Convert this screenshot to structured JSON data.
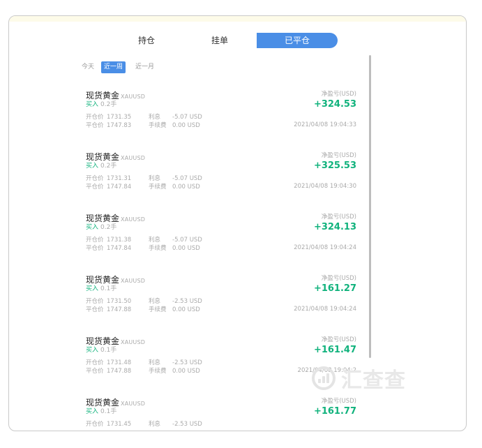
{
  "tabs": [
    {
      "label": "持仓",
      "active": false
    },
    {
      "label": "挂单",
      "active": false
    },
    {
      "label": "已平仓",
      "active": true
    }
  ],
  "filters": [
    {
      "label": "今天",
      "active": false
    },
    {
      "label": "近一周",
      "active": true
    },
    {
      "label": "近一月",
      "active": false
    }
  ],
  "trades": [
    {
      "name": "现货黄金",
      "symbol": "XAUUSD",
      "side": "买入",
      "qty": "0.2手",
      "open_label": "开仓价",
      "open_price": "1731.35",
      "close_label": "平仓价",
      "close_price": "1747.83",
      "interest_label": "利息",
      "interest": "-5.07 USD",
      "fee_label": "手续费",
      "fee": "0.00 USD",
      "pnl_label": "净盈亏(USD)",
      "pnl": "+324.53",
      "time": "2021/04/08 19:04:33"
    },
    {
      "name": "现货黄金",
      "symbol": "XAUUSD",
      "side": "买入",
      "qty": "0.2手",
      "open_label": "开仓价",
      "open_price": "1731.31",
      "close_label": "平仓价",
      "close_price": "1747.84",
      "interest_label": "利息",
      "interest": "-5.07 USD",
      "fee_label": "手续费",
      "fee": "0.00 USD",
      "pnl_label": "净盈亏(USD)",
      "pnl": "+325.53",
      "time": "2021/04/08 19:04:30"
    },
    {
      "name": "现货黄金",
      "symbol": "XAUUSD",
      "side": "买入",
      "qty": "0.2手",
      "open_label": "开仓价",
      "open_price": "1731.38",
      "close_label": "平仓价",
      "close_price": "1747.84",
      "interest_label": "利息",
      "interest": "-5.07 USD",
      "fee_label": "手续费",
      "fee": "0.00 USD",
      "pnl_label": "净盈亏(USD)",
      "pnl": "+324.13",
      "time": "2021/04/08 19:04:24"
    },
    {
      "name": "现货黄金",
      "symbol": "XAUUSD",
      "side": "买入",
      "qty": "0.1手",
      "open_label": "开仓价",
      "open_price": "1731.50",
      "close_label": "平仓价",
      "close_price": "1747.88",
      "interest_label": "利息",
      "interest": "-2.53 USD",
      "fee_label": "手续费",
      "fee": "0.00 USD",
      "pnl_label": "净盈亏(USD)",
      "pnl": "+161.27",
      "time": "2021/04/08 19:04:24"
    },
    {
      "name": "现货黄金",
      "symbol": "XAUUSD",
      "side": "买入",
      "qty": "0.1手",
      "open_label": "开仓价",
      "open_price": "1731.48",
      "close_label": "平仓价",
      "close_price": "1747.88",
      "interest_label": "利息",
      "interest": "-2.53 USD",
      "fee_label": "手续费",
      "fee": "0.00 USD",
      "pnl_label": "净盈亏(USD)",
      "pnl": "+161.47",
      "time": "2021/04/08 19:04:2"
    },
    {
      "name": "现货黄金",
      "symbol": "XAUUSD",
      "side": "买入",
      "qty": "0.1手",
      "open_label": "开仓价",
      "open_price": "1731.45",
      "close_label": "",
      "close_price": "",
      "interest_label": "利息",
      "interest": "-2.53 USD",
      "fee_label": "",
      "fee": "",
      "pnl_label": "净盈亏(USD)",
      "pnl": "+161.77",
      "time": ""
    }
  ],
  "watermark": {
    "text": "汇查查",
    "icon": "chart-magnifier-icon"
  },
  "colors": {
    "accent": "#4a8ee6",
    "profit": "#10b27c",
    "muted": "#aaaaaa"
  }
}
